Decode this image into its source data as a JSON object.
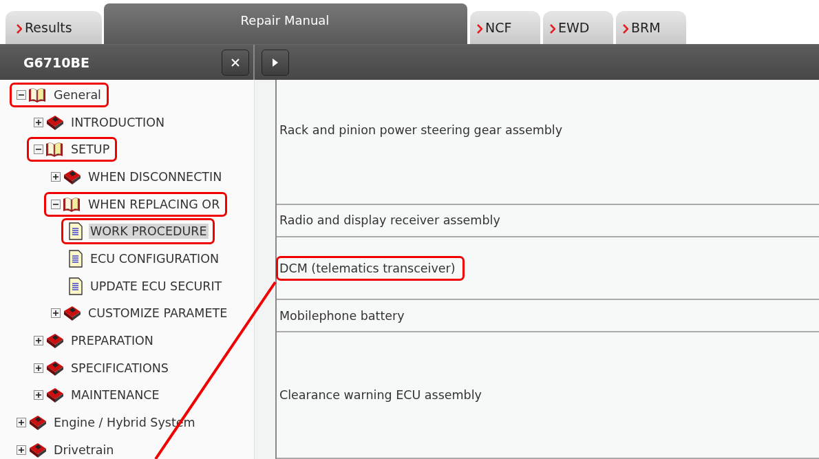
{
  "tabs": [
    {
      "label": "Results",
      "selected": false
    },
    {
      "label": "Repair Manual",
      "selected": true
    },
    {
      "label": "NCF",
      "selected": false
    },
    {
      "label": "EWD",
      "selected": false
    },
    {
      "label": "BRM",
      "selected": false
    }
  ],
  "panel": {
    "title": "G6710BE"
  },
  "tree": [
    {
      "label": "General",
      "kind": "book",
      "expanded": true,
      "selected": false,
      "annotated": true,
      "children": [
        {
          "label": "INTRODUCTION",
          "kind": "book",
          "expanded": false,
          "selected": false,
          "annotated": false
        },
        {
          "label": "SETUP",
          "kind": "book",
          "expanded": true,
          "selected": false,
          "annotated": true,
          "children": [
            {
              "label": "WHEN DISCONNECTIN",
              "kind": "book",
              "expanded": false,
              "selected": false,
              "annotated": false
            },
            {
              "label": "WHEN REPLACING OR",
              "kind": "book",
              "expanded": true,
              "selected": false,
              "annotated": true,
              "children": [
                {
                  "label": "WORK PROCEDURE",
                  "kind": "page",
                  "selected": true,
                  "annotated": true
                },
                {
                  "label": "ECU CONFIGURATION",
                  "kind": "page",
                  "selected": false,
                  "annotated": false
                },
                {
                  "label": "UPDATE ECU SECURIT",
                  "kind": "page",
                  "selected": false,
                  "annotated": false
                }
              ]
            },
            {
              "label": "CUSTOMIZE PARAMETE",
              "kind": "book",
              "expanded": false,
              "selected": false,
              "annotated": false
            }
          ]
        },
        {
          "label": "PREPARATION",
          "kind": "book",
          "expanded": false,
          "selected": false,
          "annotated": false
        },
        {
          "label": "SPECIFICATIONS",
          "kind": "book",
          "expanded": false,
          "selected": false,
          "annotated": false
        },
        {
          "label": "MAINTENANCE",
          "kind": "book",
          "expanded": false,
          "selected": false,
          "annotated": false
        }
      ]
    },
    {
      "label": "Engine / Hybrid System",
      "kind": "book",
      "expanded": false,
      "selected": false,
      "annotated": false
    },
    {
      "label": "Drivetrain",
      "kind": "book",
      "expanded": false,
      "selected": false,
      "annotated": false
    }
  ],
  "rows": [
    {
      "text": "Rack and pinion power steering gear assembly",
      "annotated": false
    },
    {
      "text": "Radio and display receiver assembly",
      "annotated": false
    },
    {
      "text": "DCM (telematics transceiver)",
      "annotated": true
    },
    {
      "text": "Mobilephone battery",
      "annotated": false
    },
    {
      "text": "Clearance warning ECU assembly",
      "annotated": false
    }
  ]
}
